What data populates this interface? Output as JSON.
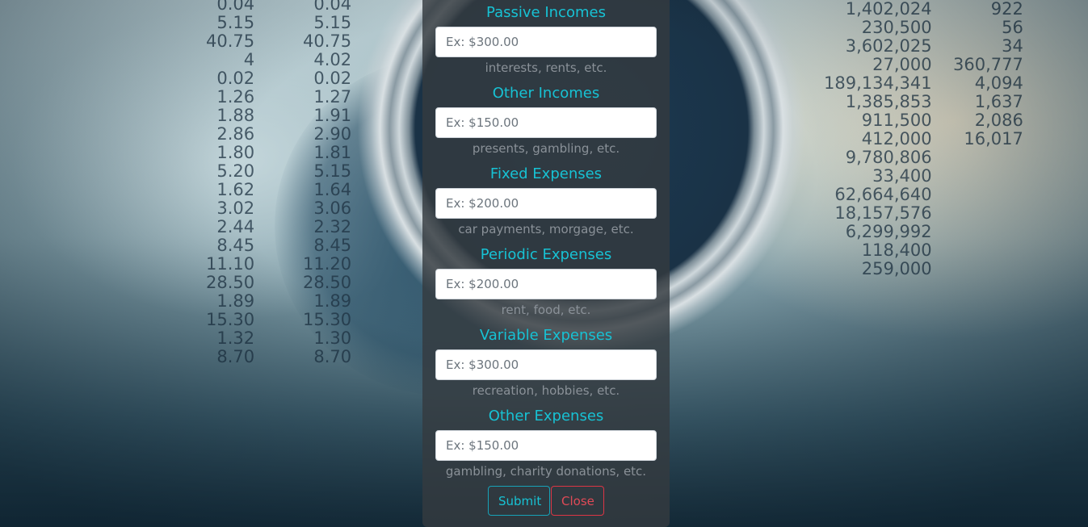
{
  "form": {
    "fields": [
      {
        "title": "Passive Incomes",
        "placeholder": "Ex: $300.00",
        "help": "interests, rents, etc."
      },
      {
        "title": "Other Incomes",
        "placeholder": "Ex: $150.00",
        "help": "presents, gambling, etc."
      },
      {
        "title": "Fixed Expenses",
        "placeholder": "Ex: $200.00",
        "help": "car payments, morgage, etc."
      },
      {
        "title": "Periodic Expenses",
        "placeholder": "Ex: $200.00",
        "help": "rent, food, etc."
      },
      {
        "title": "Variable Expenses",
        "placeholder": "Ex: $300.00",
        "help": "recreation, hobbies, etc."
      },
      {
        "title": "Other Expenses",
        "placeholder": "Ex: $150.00",
        "help": "gambling, charity donations, etc."
      }
    ],
    "submit_label": "Submit",
    "close_label": "Close"
  },
  "colors": {
    "accent": "#17a2b8",
    "danger": "#dc3545",
    "panel": "#343a40"
  }
}
